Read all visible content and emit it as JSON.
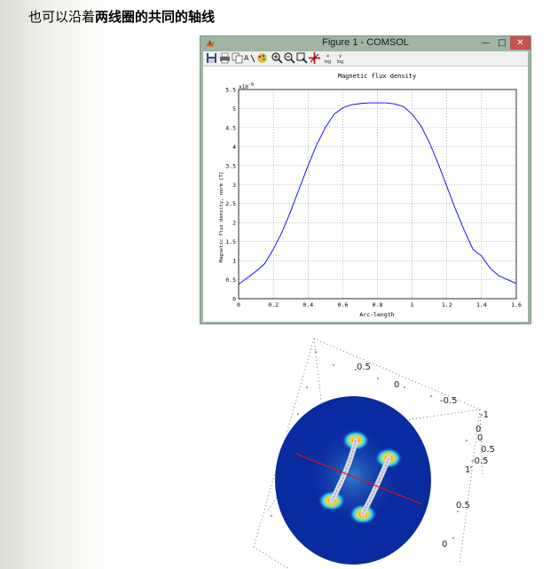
{
  "heading": {
    "prefix": "也可以沿着",
    "emphasis": "两线圈的共同的轴线"
  },
  "figure_window": {
    "title": "Figure 1 - COMSOL",
    "toolbar_icons": [
      "save-icon",
      "print-icon",
      "copy-icon",
      "text-tool-icon",
      "palette-icon",
      "zoom-in-icon",
      "zoom-out-icon",
      "zoom-box-icon",
      "axis-tool-icon",
      "x-log-icon",
      "y-log-icon"
    ],
    "x_log_label": "x\nlog",
    "y_log_label": "y\nlog"
  },
  "chart_data": {
    "type": "line",
    "title": "Magnetic flux density",
    "xlabel": "Arc-length",
    "ylabel": "Magnetic flux density, norm [T]",
    "y_exponent_label": "x10^-9",
    "xlim": [
      0,
      1.6
    ],
    "ylim": [
      0,
      5.5
    ],
    "xticks": [
      "0",
      "0.2",
      "0.4",
      "0.6",
      "0.8",
      "1",
      "1.2",
      "1.4",
      "1.6"
    ],
    "yticks": [
      "0",
      "0.5",
      "1",
      "1.5",
      "2",
      "2.5",
      "3",
      "3.5",
      "4",
      "4.5",
      "5",
      "5.5"
    ],
    "grid": true,
    "series": [
      {
        "color": "#0000ff",
        "x": [
          0,
          0.05,
          0.1,
          0.15,
          0.2,
          0.25,
          0.3,
          0.35,
          0.4,
          0.45,
          0.5,
          0.55,
          0.6,
          0.65,
          0.7,
          0.75,
          0.8,
          0.85,
          0.9,
          0.95,
          1.0,
          1.05,
          1.1,
          1.15,
          1.2,
          1.25,
          1.3,
          1.35,
          1.4,
          1.45,
          1.5,
          1.55,
          1.6
        ],
        "y": [
          0.38,
          0.55,
          0.72,
          0.92,
          1.3,
          1.75,
          2.3,
          2.9,
          3.5,
          4.05,
          4.5,
          4.85,
          5.02,
          5.1,
          5.13,
          5.15,
          5.15,
          5.15,
          5.12,
          5.05,
          4.85,
          4.55,
          4.1,
          3.55,
          2.95,
          2.35,
          1.8,
          1.3,
          1.12,
          0.8,
          0.6,
          0.5,
          0.4
        ]
      }
    ]
  },
  "render3d": {
    "axis_labels": [
      "0.5",
      "0",
      "-0.5",
      "-1",
      "0",
      "0.5",
      "0",
      "-0.5",
      "1",
      "0.5",
      "0"
    ],
    "disk_color": "#0a2aa0",
    "axis_line_color": "#dd1111"
  }
}
